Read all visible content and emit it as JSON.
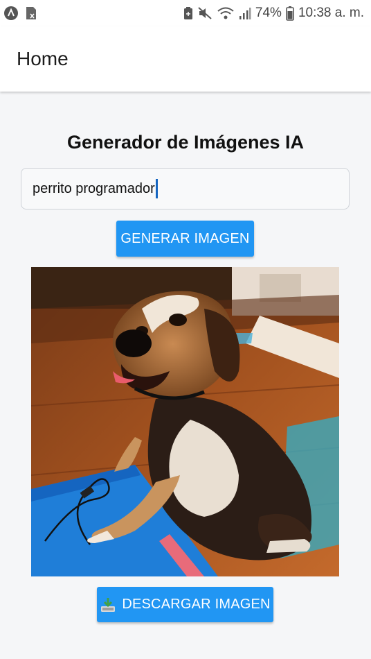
{
  "status_bar": {
    "battery_percent": "74%",
    "time": "10:38 a. m.",
    "icons": [
      "app-a-icon",
      "sim-icon",
      "battery-saver-icon",
      "mute-icon",
      "wifi-icon",
      "signal-icon",
      "battery-icon"
    ]
  },
  "app_bar": {
    "title": "Home"
  },
  "main": {
    "heading": "Generador de Imágenes IA",
    "prompt_value": "perrito programador",
    "generate_label": "GENERAR IMAGEN",
    "download_label": "DESCARGAR IMAGEN",
    "download_icon": "download-tray-icon"
  },
  "colors": {
    "accent": "#2196f3",
    "background": "#f5f6f8",
    "caret": "#1565c0"
  }
}
